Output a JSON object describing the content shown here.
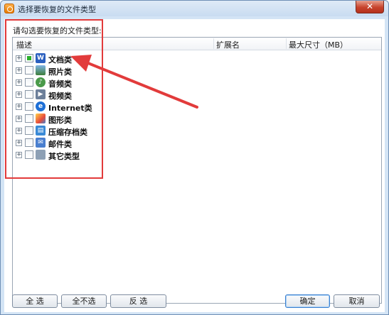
{
  "window": {
    "title": "选择要恢复的文件类型",
    "close_symbol": "✕"
  },
  "group_label": "请勾选要恢复的文件类型:",
  "list": {
    "columns": [
      "描述",
      "扩展名",
      "最大尺寸（MB）"
    ],
    "items": [
      {
        "label": "文档类",
        "icon": "word-document-icon",
        "glyph": "W",
        "checked": "partial"
      },
      {
        "label": "照片类",
        "icon": "photo-icon",
        "glyph": "",
        "checked": "none"
      },
      {
        "label": "音频类",
        "icon": "audio-icon",
        "glyph": "♪",
        "checked": "none"
      },
      {
        "label": "视频类",
        "icon": "video-icon",
        "glyph": "▶",
        "checked": "none"
      },
      {
        "label": "Internet类",
        "icon": "internet-explorer-icon",
        "glyph": "e",
        "checked": "none"
      },
      {
        "label": "图形类",
        "icon": "graphics-icon",
        "glyph": "",
        "checked": "none"
      },
      {
        "label": "压缩存档类",
        "icon": "archive-icon",
        "glyph": "▤",
        "checked": "none"
      },
      {
        "label": "邮件类",
        "icon": "mail-icon",
        "glyph": "✉",
        "checked": "none"
      },
      {
        "label": "其它类型",
        "icon": "other-file-icon",
        "glyph": "",
        "checked": "none"
      }
    ],
    "expander_symbol": "+"
  },
  "buttons": {
    "select_all": "全 选",
    "select_none": "全不选",
    "invert": "反 选",
    "ok": "确定",
    "cancel": "取消"
  },
  "annotation": {
    "color": "#e23b3b"
  }
}
